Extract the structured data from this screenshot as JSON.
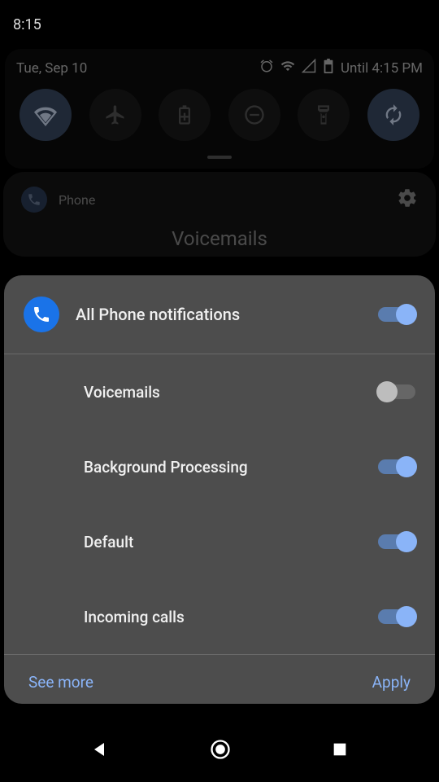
{
  "statusBar": {
    "time": "8:15"
  },
  "quickSettings": {
    "date": "Tue, Sep 10",
    "until": "Until 4:15 PM"
  },
  "phoneCard": {
    "appName": "Phone",
    "subtitle": "Voicemails"
  },
  "notificationSheet": {
    "headerLabel": "All Phone notifications",
    "headerEnabled": true,
    "items": [
      {
        "label": "Voicemails",
        "enabled": false
      },
      {
        "label": "Background Processing",
        "enabled": true
      },
      {
        "label": "Default",
        "enabled": true
      },
      {
        "label": "Incoming calls",
        "enabled": true
      }
    ],
    "seeMore": "See more",
    "apply": "Apply"
  },
  "colors": {
    "accent": "#8ab4f8",
    "accentDark": "#1a73e8"
  }
}
